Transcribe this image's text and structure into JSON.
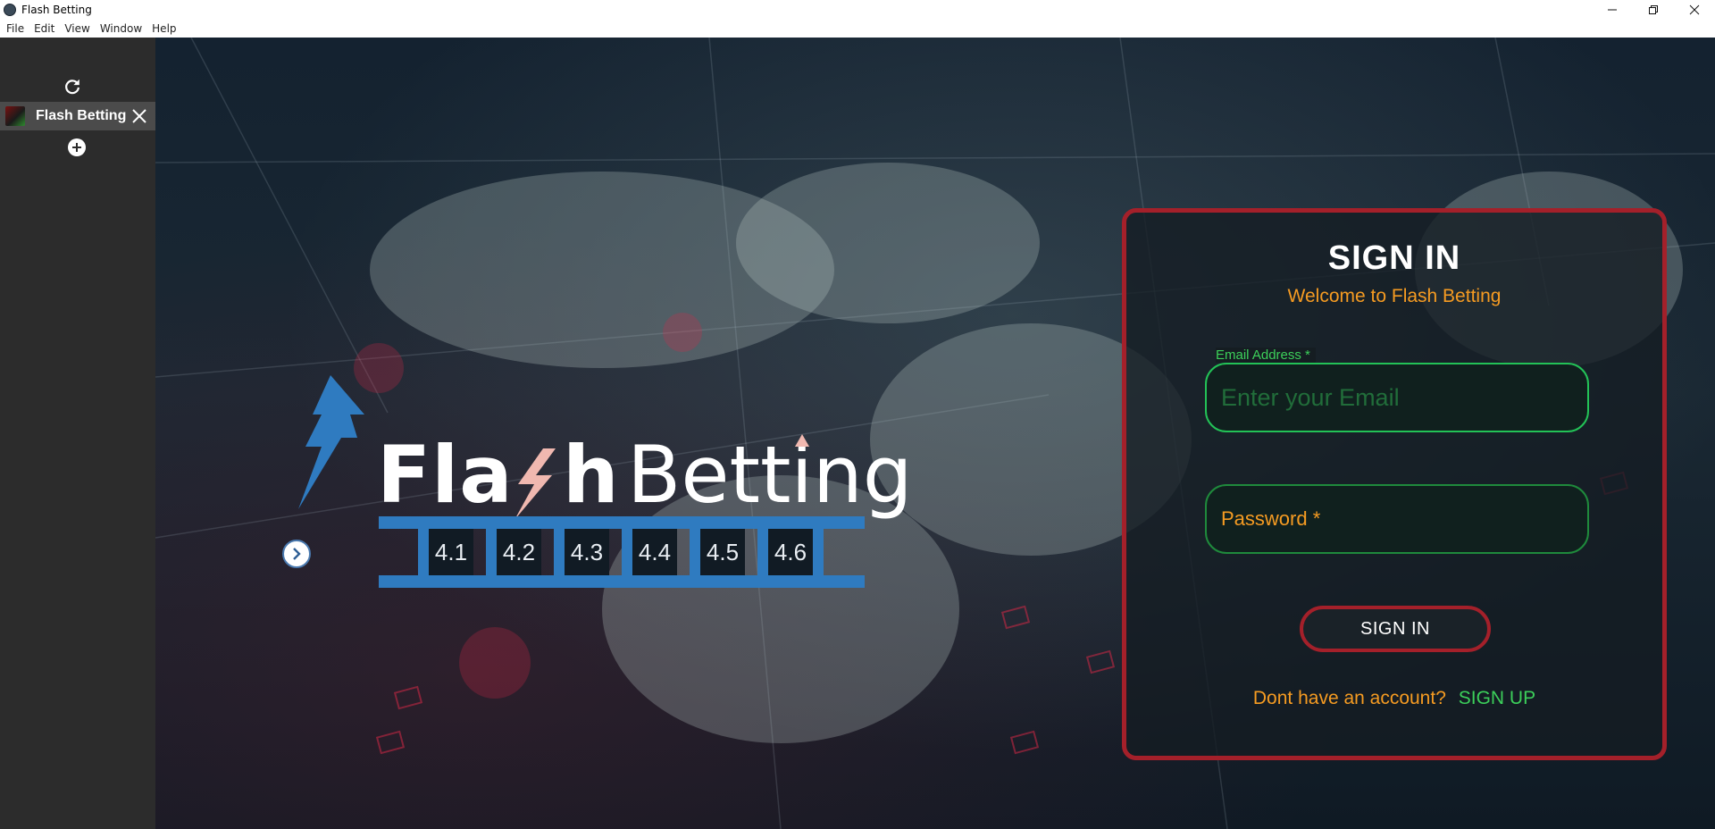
{
  "window": {
    "title": "Flash Betting",
    "controls": [
      "minimize",
      "restore",
      "close"
    ]
  },
  "menu": [
    "File",
    "Edit",
    "View",
    "Window",
    "Help"
  ],
  "sidebar": {
    "tab": {
      "label": "Flash Betting"
    }
  },
  "logo": {
    "part1": "Fla",
    "part2": "h",
    "part3": "Betting",
    "versions": [
      "4.1",
      "4.2",
      "4.3",
      "4.4",
      "4.5",
      "4.6"
    ]
  },
  "signin": {
    "title": "SIGN IN",
    "subtitle": "Welcome to Flash Betting",
    "email_label": "Email Address *",
    "email_placeholder": "Enter your Email",
    "password_placeholder": "Password *",
    "button_label": "SIGN IN",
    "signup_question": "Dont have an account?",
    "signup_link": "SIGN UP"
  },
  "colors": {
    "card_border": "#a4202a",
    "accent_orange": "#f59b22",
    "accent_green": "#3ccf5a",
    "logo_blue": "#2f7bc0"
  }
}
